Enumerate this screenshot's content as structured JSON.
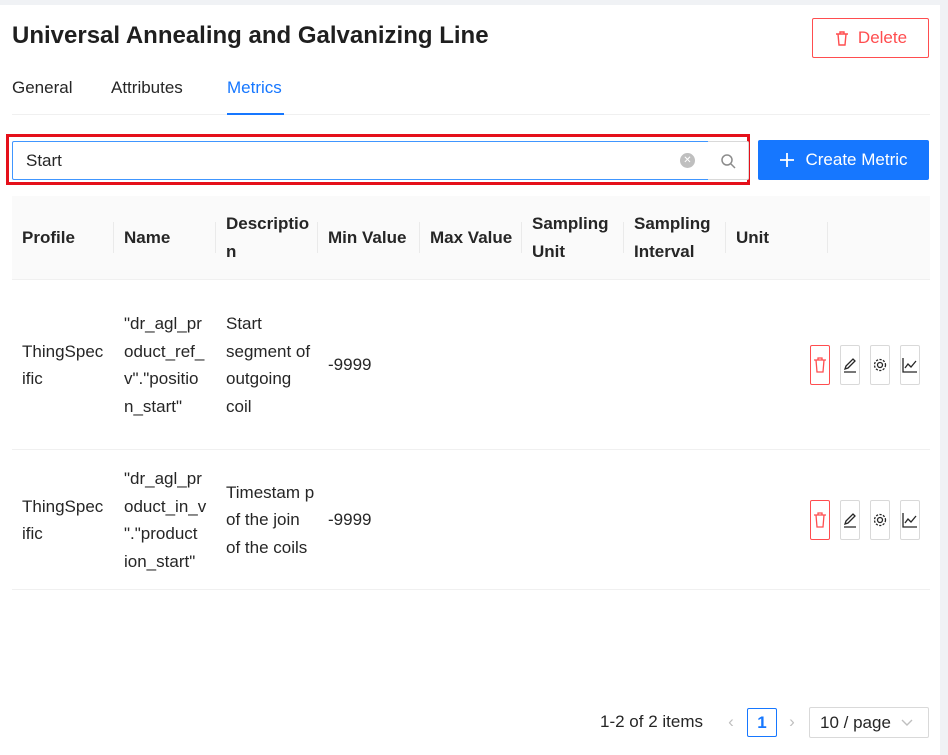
{
  "header": {
    "title": "Universal Annealing and Galvanizing Line",
    "delete_label": "Delete"
  },
  "tabs": [
    {
      "label": "General"
    },
    {
      "label": "Attributes"
    },
    {
      "label": "Metrics"
    }
  ],
  "active_tab": "Metrics",
  "search": {
    "value": "Start",
    "placeholder": ""
  },
  "create_label": "Create Metric",
  "table": {
    "columns": [
      {
        "label": "Profile"
      },
      {
        "label": "Name"
      },
      {
        "label": "Descriptio n"
      },
      {
        "label": "Min Value"
      },
      {
        "label": "Max Value"
      },
      {
        "label": "Sampling Unit"
      },
      {
        "label": "Sampling Interval"
      },
      {
        "label": "Unit"
      }
    ],
    "rows": [
      {
        "profile": "ThingSpec ific",
        "name": "\"dr_agl_pr oduct_ref_ v\".\"positio n_start\"",
        "description": "Start segment of outgoing coil",
        "min_value": "-9999",
        "max_value": "",
        "sampling_unit": "",
        "sampling_interval": "",
        "unit": ""
      },
      {
        "profile": "ThingSpec ific",
        "name": "\"dr_agl_pr oduct_in_v \".\"product ion_start\"",
        "description": "Timestam p of the join of the coils",
        "min_value": "-9999",
        "max_value": "",
        "sampling_unit": "",
        "sampling_interval": "",
        "unit": ""
      }
    ]
  },
  "pagination": {
    "total": "1-2 of 2 items",
    "current_page": "1",
    "page_size": "10 / page"
  },
  "colors": {
    "primary": "#1677ff",
    "danger": "#ff4d4f",
    "highlight": "#e5101a"
  }
}
